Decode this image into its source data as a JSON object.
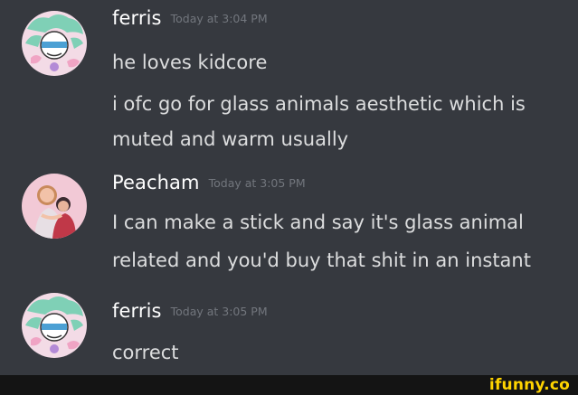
{
  "messages": [
    {
      "username": "ferris",
      "timestamp": "Today at 3:04 PM",
      "lines": [
        "he loves kidcore",
        "i ofc go for glass animals aesthetic which is",
        "muted and warm usually"
      ]
    },
    {
      "username": "Peacham",
      "timestamp": "Today at 3:05 PM",
      "lines": [
        "I can make a stick and say it's glass animal",
        "related and you'd buy that shit in an instant"
      ]
    },
    {
      "username": "ferris",
      "timestamp": "Today at 3:05 PM",
      "lines": [
        "correct"
      ]
    }
  ],
  "watermark": "ifunny.co",
  "colors": {
    "background": "#36393f",
    "username": "#ffffff",
    "timestamp": "#72767d",
    "message_text": "#dcddde",
    "watermark": "#ffd400"
  }
}
